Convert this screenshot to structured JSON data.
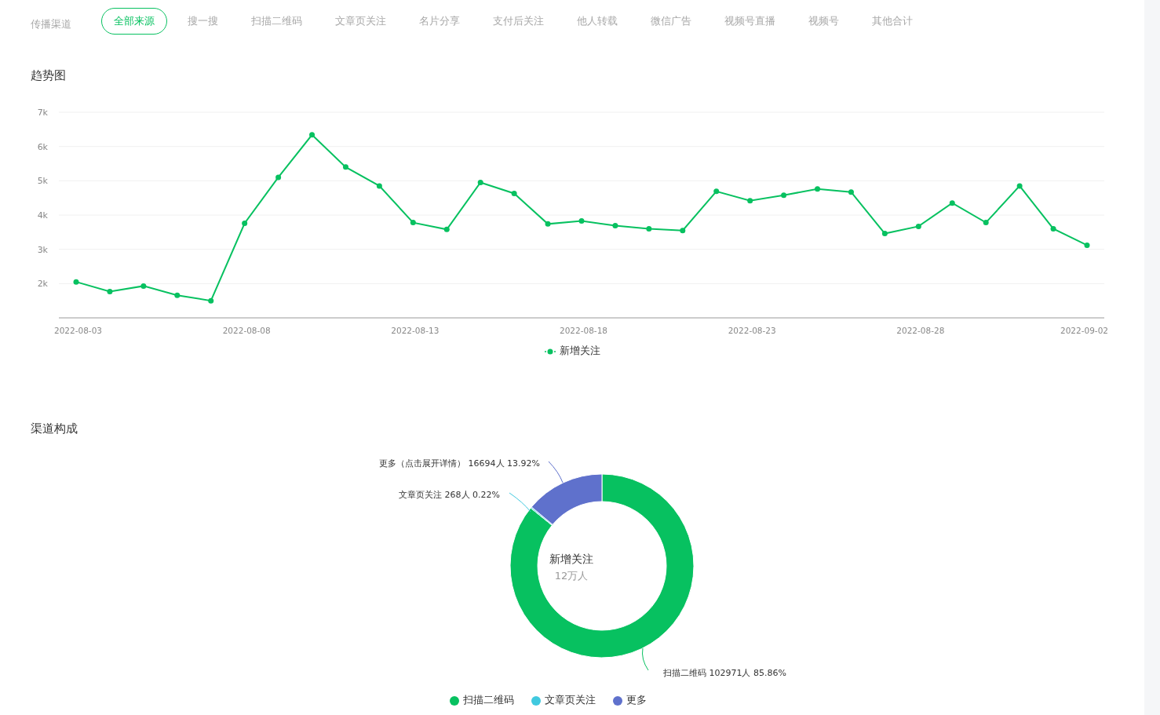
{
  "channel_label": "传播渠道",
  "tabs": [
    {
      "label": "全部来源",
      "selected": true
    },
    {
      "label": "搜一搜",
      "selected": false
    },
    {
      "label": "扫描二维码",
      "selected": false
    },
    {
      "label": "文章页关注",
      "selected": false
    },
    {
      "label": "名片分享",
      "selected": false
    },
    {
      "label": "支付后关注",
      "selected": false
    },
    {
      "label": "他人转载",
      "selected": false
    },
    {
      "label": "微信广告",
      "selected": false
    },
    {
      "label": "视频号直播",
      "selected": false
    },
    {
      "label": "视频号",
      "selected": false
    },
    {
      "label": "其他合计",
      "selected": false
    }
  ],
  "trend": {
    "title": "趋势图",
    "chart_data": {
      "type": "line",
      "categories": [
        "2022-08-03",
        null,
        null,
        null,
        null,
        "2022-08-08",
        null,
        null,
        null,
        null,
        "2022-08-13",
        null,
        null,
        null,
        null,
        "2022-08-18",
        null,
        null,
        null,
        null,
        "2022-08-23",
        null,
        null,
        null,
        null,
        "2022-08-28",
        null,
        null,
        null,
        null,
        "2022-09-02"
      ],
      "series": [
        {
          "name": "新增关注",
          "color": "#07c160",
          "marker": "circle",
          "values": [
            2050,
            1770,
            1930,
            1660,
            1500,
            3760,
            5100,
            6340,
            5400,
            4850,
            3780,
            3580,
            4950,
            4630,
            3740,
            3830,
            3690,
            3600,
            3550,
            4690,
            4420,
            4580,
            4760,
            4670,
            3460,
            3670,
            4350,
            3780,
            4850,
            3600,
            3120
          ]
        }
      ],
      "grid": true,
      "ylim": [
        1000,
        7000
      ],
      "yticks": [
        {
          "value": 2000,
          "label": "2k"
        },
        {
          "value": 3000,
          "label": "3k"
        },
        {
          "value": 4000,
          "label": "4k"
        },
        {
          "value": 5000,
          "label": "5k"
        },
        {
          "value": 6000,
          "label": "6k"
        },
        {
          "value": 7000,
          "label": "7k"
        }
      ]
    }
  },
  "composition": {
    "title": "渠道构成",
    "center_value": "12万人",
    "chart_data": {
      "type": "donut",
      "categories": [
        "扫描二维码",
        "文章页关注",
        "更多"
      ],
      "series": [
        {
          "name": "新增关注",
          "values": [
            85.86,
            0.22,
            13.92
          ]
        }
      ],
      "colors": [
        "#07c160",
        "#40c9df",
        "#5f71cc"
      ],
      "value_labels": [
        "扫描二维码 102971人 85.86%",
        "文章页关注 268人 0.22%",
        "更多（点击展开详情） 16694人 13.92%"
      ]
    }
  }
}
